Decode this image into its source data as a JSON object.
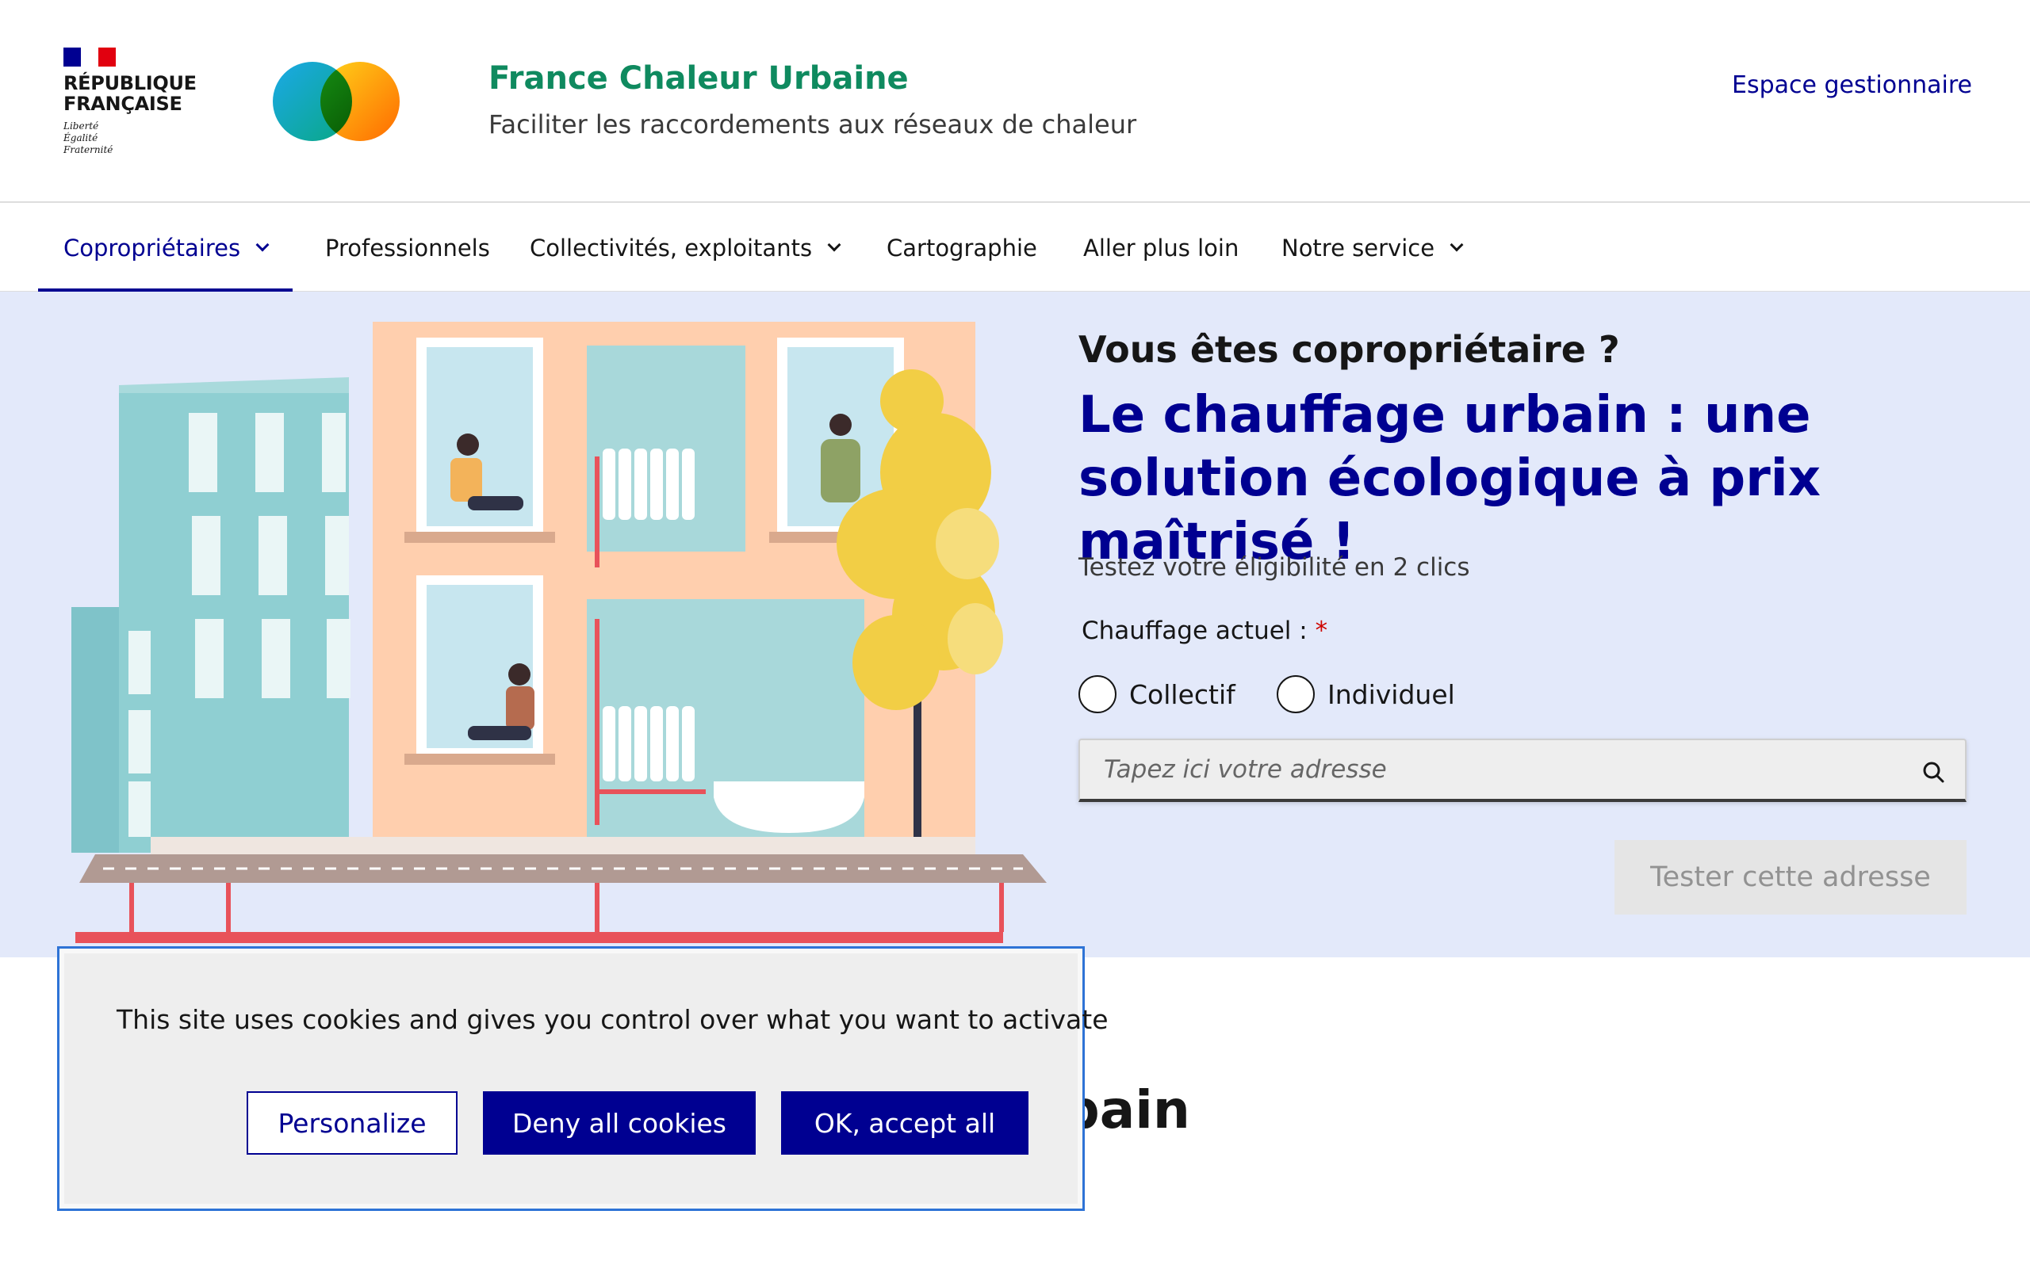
{
  "header": {
    "gov_name_line1": "RÉPUBLIQUE",
    "gov_name_line2": "FRANÇAISE",
    "motto_line1": "Liberté",
    "motto_line2": "Égalité",
    "motto_line3": "Fraternité",
    "site_title": "France Chaleur Urbaine",
    "site_tagline": "Faciliter les raccordements aux réseaux de chaleur",
    "manager_link": "Espace gestionnaire"
  },
  "nav": {
    "items": [
      {
        "label": "Copropriétaires",
        "has_dropdown": true,
        "active": true
      },
      {
        "label": "Professionnels",
        "has_dropdown": false,
        "active": false
      },
      {
        "label": "Collectivités, exploitants",
        "has_dropdown": true,
        "active": false
      },
      {
        "label": "Cartographie",
        "has_dropdown": false,
        "active": false
      },
      {
        "label": "Aller plus loin",
        "has_dropdown": false,
        "active": false
      },
      {
        "label": "Notre service",
        "has_dropdown": true,
        "active": false
      }
    ]
  },
  "hero": {
    "pre_title": "Vous êtes copropriétaire ?",
    "title": "Le chauffage urbain : une solution écologique à prix maîtrisé !",
    "subtitle": "Testez votre éligibilité en 2 clics",
    "heating_label": "Chauffage actuel :",
    "required_mark": "*",
    "radio_options": [
      "Collectif",
      "Individuel"
    ],
    "address_placeholder": "Tapez ici votre adresse",
    "address_value": "",
    "test_button": "Tester cette adresse"
  },
  "section": {
    "heading_visible": "uffage urbain"
  },
  "cookie_banner": {
    "message": "This site uses cookies and gives you control over what you want to activate",
    "personalize": "Personalize",
    "deny": "Deny all cookies",
    "accept": "OK, accept all"
  },
  "colors": {
    "primary_blue": "#000091",
    "brand_green": "#0f8a5f",
    "hero_bg": "#e3e9fa",
    "cookie_border": "#2e73d6",
    "required_red": "#ce0500"
  },
  "icons": [
    "marianne-logo",
    "fcu-logo",
    "chevron-down-icon",
    "search-icon"
  ]
}
